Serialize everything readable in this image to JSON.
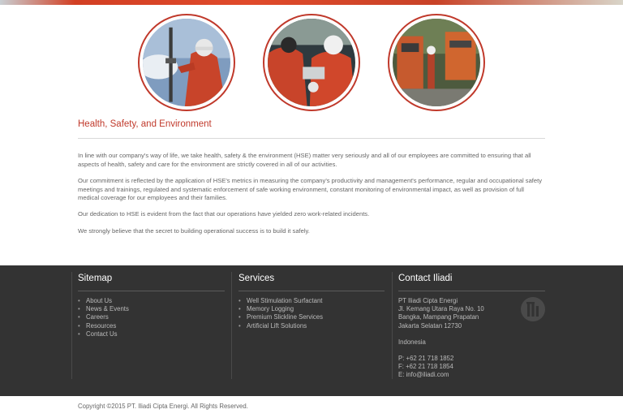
{
  "colors": {
    "accent": "#c0392b",
    "footer_bg": "#333333"
  },
  "photos": [
    {
      "name": "worker-on-rig-photo"
    },
    {
      "name": "workers-with-equipment-photo"
    },
    {
      "name": "field-equipment-photo"
    }
  ],
  "main": {
    "title": "Health, Safety, and Environment",
    "paragraphs": [
      "In line with our company's way of life, we take health, safety & the environment (HSE) matter very seriously and all of our employees are committed to ensuring that all aspects of health, safety and care for the environment are strictly covered in all of our activities.",
      "Our commitment is reflected by the application of HSE's metrics in measuring the company's productivity and management's performance, regular and occupational safety meetings and trainings, regulated and systematic enforcement of safe working environment, constant monitoring of environmental impact, as well as provision of full medical coverage for our employees and their families.",
      "Our dedication to HSE is evident from the fact that our operations have yielded zero work-related incidents.",
      "We strongly believe that the secret to building operational success is to build it safely."
    ]
  },
  "footer": {
    "sitemap": {
      "title": "Sitemap",
      "items": [
        "About Us",
        "News & Events",
        "Careers",
        "Resources",
        "Contact Us"
      ]
    },
    "services": {
      "title": "Services",
      "items": [
        "Well Stimulation Surfactant",
        "Memory Logging",
        "Premium Slickline Services",
        "Artificial Lift Solutions"
      ]
    },
    "contact": {
      "title": "Contact Iliadi",
      "company": "PT Iliadi Cipta Energi",
      "address1": "Jl. Kemang Utara Raya No. 10",
      "address2": "Bangka, Mampang Prapatan",
      "address3": "Jakarta Selatan 12730",
      "country": "Indonesia",
      "phone": "P: +62 21 718 1852",
      "fax": "F: +62 21 718 1854",
      "email": "E: info@iliadi.com"
    }
  },
  "copyright": "Copyright ©2015 PT. Iliadi Cipta Energi. All Rights Reserved."
}
